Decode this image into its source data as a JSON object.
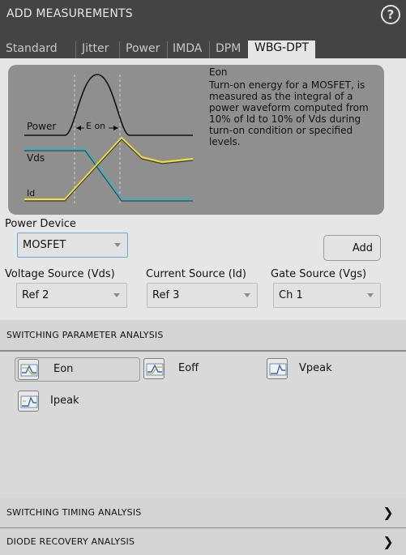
{
  "header": {
    "title": "ADD MEASUREMENTS",
    "help_icon": "?"
  },
  "tabs": [
    {
      "label": "Standard"
    },
    {
      "label": "Jitter"
    },
    {
      "label": "Power"
    },
    {
      "label": "IMDA"
    },
    {
      "label": "DPM"
    },
    {
      "label": "WBG-DPT",
      "active": true
    }
  ],
  "diagram": {
    "labels": {
      "power": "Power",
      "vds": "Vds",
      "id": "Id",
      "eon": "E on"
    },
    "colors": {
      "vds": "#28b7c9",
      "id": "#f2e12e",
      "power": "#111111"
    },
    "name": "Eon",
    "description": "Turn-on energy for a MOSFET, is measured as the integral of a power waveform computed from 10% of Id to 10% of Vds during turn-on condition or specified levels."
  },
  "power_device": {
    "label": "Power Device",
    "value": "MOSFET"
  },
  "add_button": "Add",
  "sources": {
    "voltage": {
      "label": "Voltage Source (Vds)",
      "value": "Ref 2"
    },
    "current": {
      "label": "Current Source (Id)",
      "value": "Ref 3"
    },
    "gate": {
      "label": "Gate Source (Vgs)",
      "value": "Ch 1"
    }
  },
  "sections": {
    "switching_parameter": "SWITCHING PARAMETER ANALYSIS",
    "switching_timing": "SWITCHING TIMING ANALYSIS",
    "diode_recovery": "DIODE RECOVERY ANALYSIS"
  },
  "measurements": [
    {
      "label": "Eon",
      "icon": "eon-icon",
      "selected": true
    },
    {
      "label": "Eoff",
      "icon": "eoff-icon"
    },
    {
      "label": "Vpeak",
      "icon": "vpeak-icon"
    },
    {
      "label": "Ipeak",
      "icon": "ipeak-icon"
    }
  ]
}
